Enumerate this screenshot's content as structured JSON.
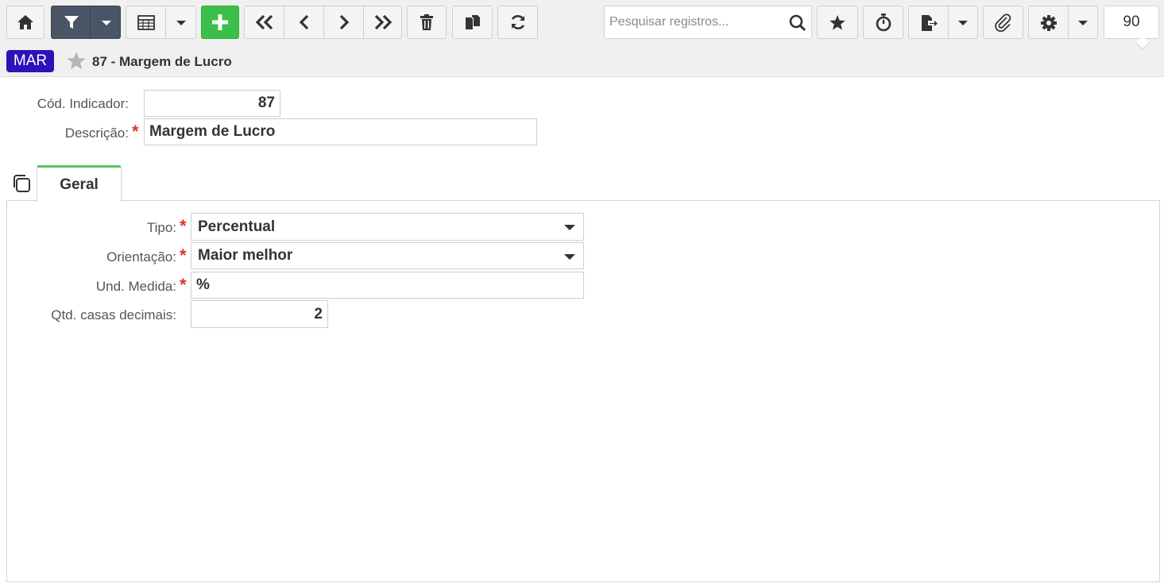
{
  "toolbar": {
    "buttons": [
      {
        "name": "home-button",
        "icon": "home-icon"
      },
      {
        "name": "filter-button",
        "icon": "filter-icon"
      },
      {
        "name": "grid-view-button",
        "icon": "table-icon"
      },
      {
        "name": "add-button",
        "icon": "plus-icon"
      },
      {
        "name": "first-record-button",
        "icon": "double-chevron-left-icon"
      },
      {
        "name": "previous-record-button",
        "icon": "chevron-left-icon"
      },
      {
        "name": "next-record-button",
        "icon": "chevron-right-icon"
      },
      {
        "name": "last-record-button",
        "icon": "double-chevron-right-icon"
      },
      {
        "name": "delete-button",
        "icon": "trash-icon"
      },
      {
        "name": "duplicate-button",
        "icon": "copy-icon"
      },
      {
        "name": "refresh-button",
        "icon": "refresh-icon"
      },
      {
        "name": "favorite-button",
        "icon": "star-icon"
      },
      {
        "name": "timer-button",
        "icon": "stopwatch-icon"
      },
      {
        "name": "export-button",
        "icon": "file-export-icon"
      },
      {
        "name": "attachment-button",
        "icon": "paperclip-icon"
      },
      {
        "name": "settings-button",
        "icon": "gear-icon"
      }
    ],
    "search_placeholder": "Pesquisar registros...",
    "record_count": "90"
  },
  "header": {
    "badge": "MAR",
    "title": "87 - Margem de Lucro"
  },
  "form": {
    "cod_indicador": {
      "label": "Cód. Indicador:",
      "value": "87"
    },
    "descricao": {
      "label": "Descrição:",
      "value": "Margem de Lucro",
      "required": true
    }
  },
  "tabs": [
    {
      "label": "Geral",
      "active": true
    }
  ],
  "geral": {
    "tipo": {
      "label": "Tipo:",
      "value": "Percentual",
      "required": true
    },
    "orientacao": {
      "label": "Orientação:",
      "value": "Maior melhor",
      "required": true
    },
    "und_medida": {
      "label": "Und. Medida:",
      "value": "%",
      "required": true
    },
    "casas_decimais": {
      "label": "Qtd. casas decimais:",
      "value": "2"
    }
  },
  "colors": {
    "accent_green": "#3cbf4a",
    "badge_blue": "#2d12b8",
    "required_red": "#d9342b",
    "tab_active": "#5cc463"
  }
}
